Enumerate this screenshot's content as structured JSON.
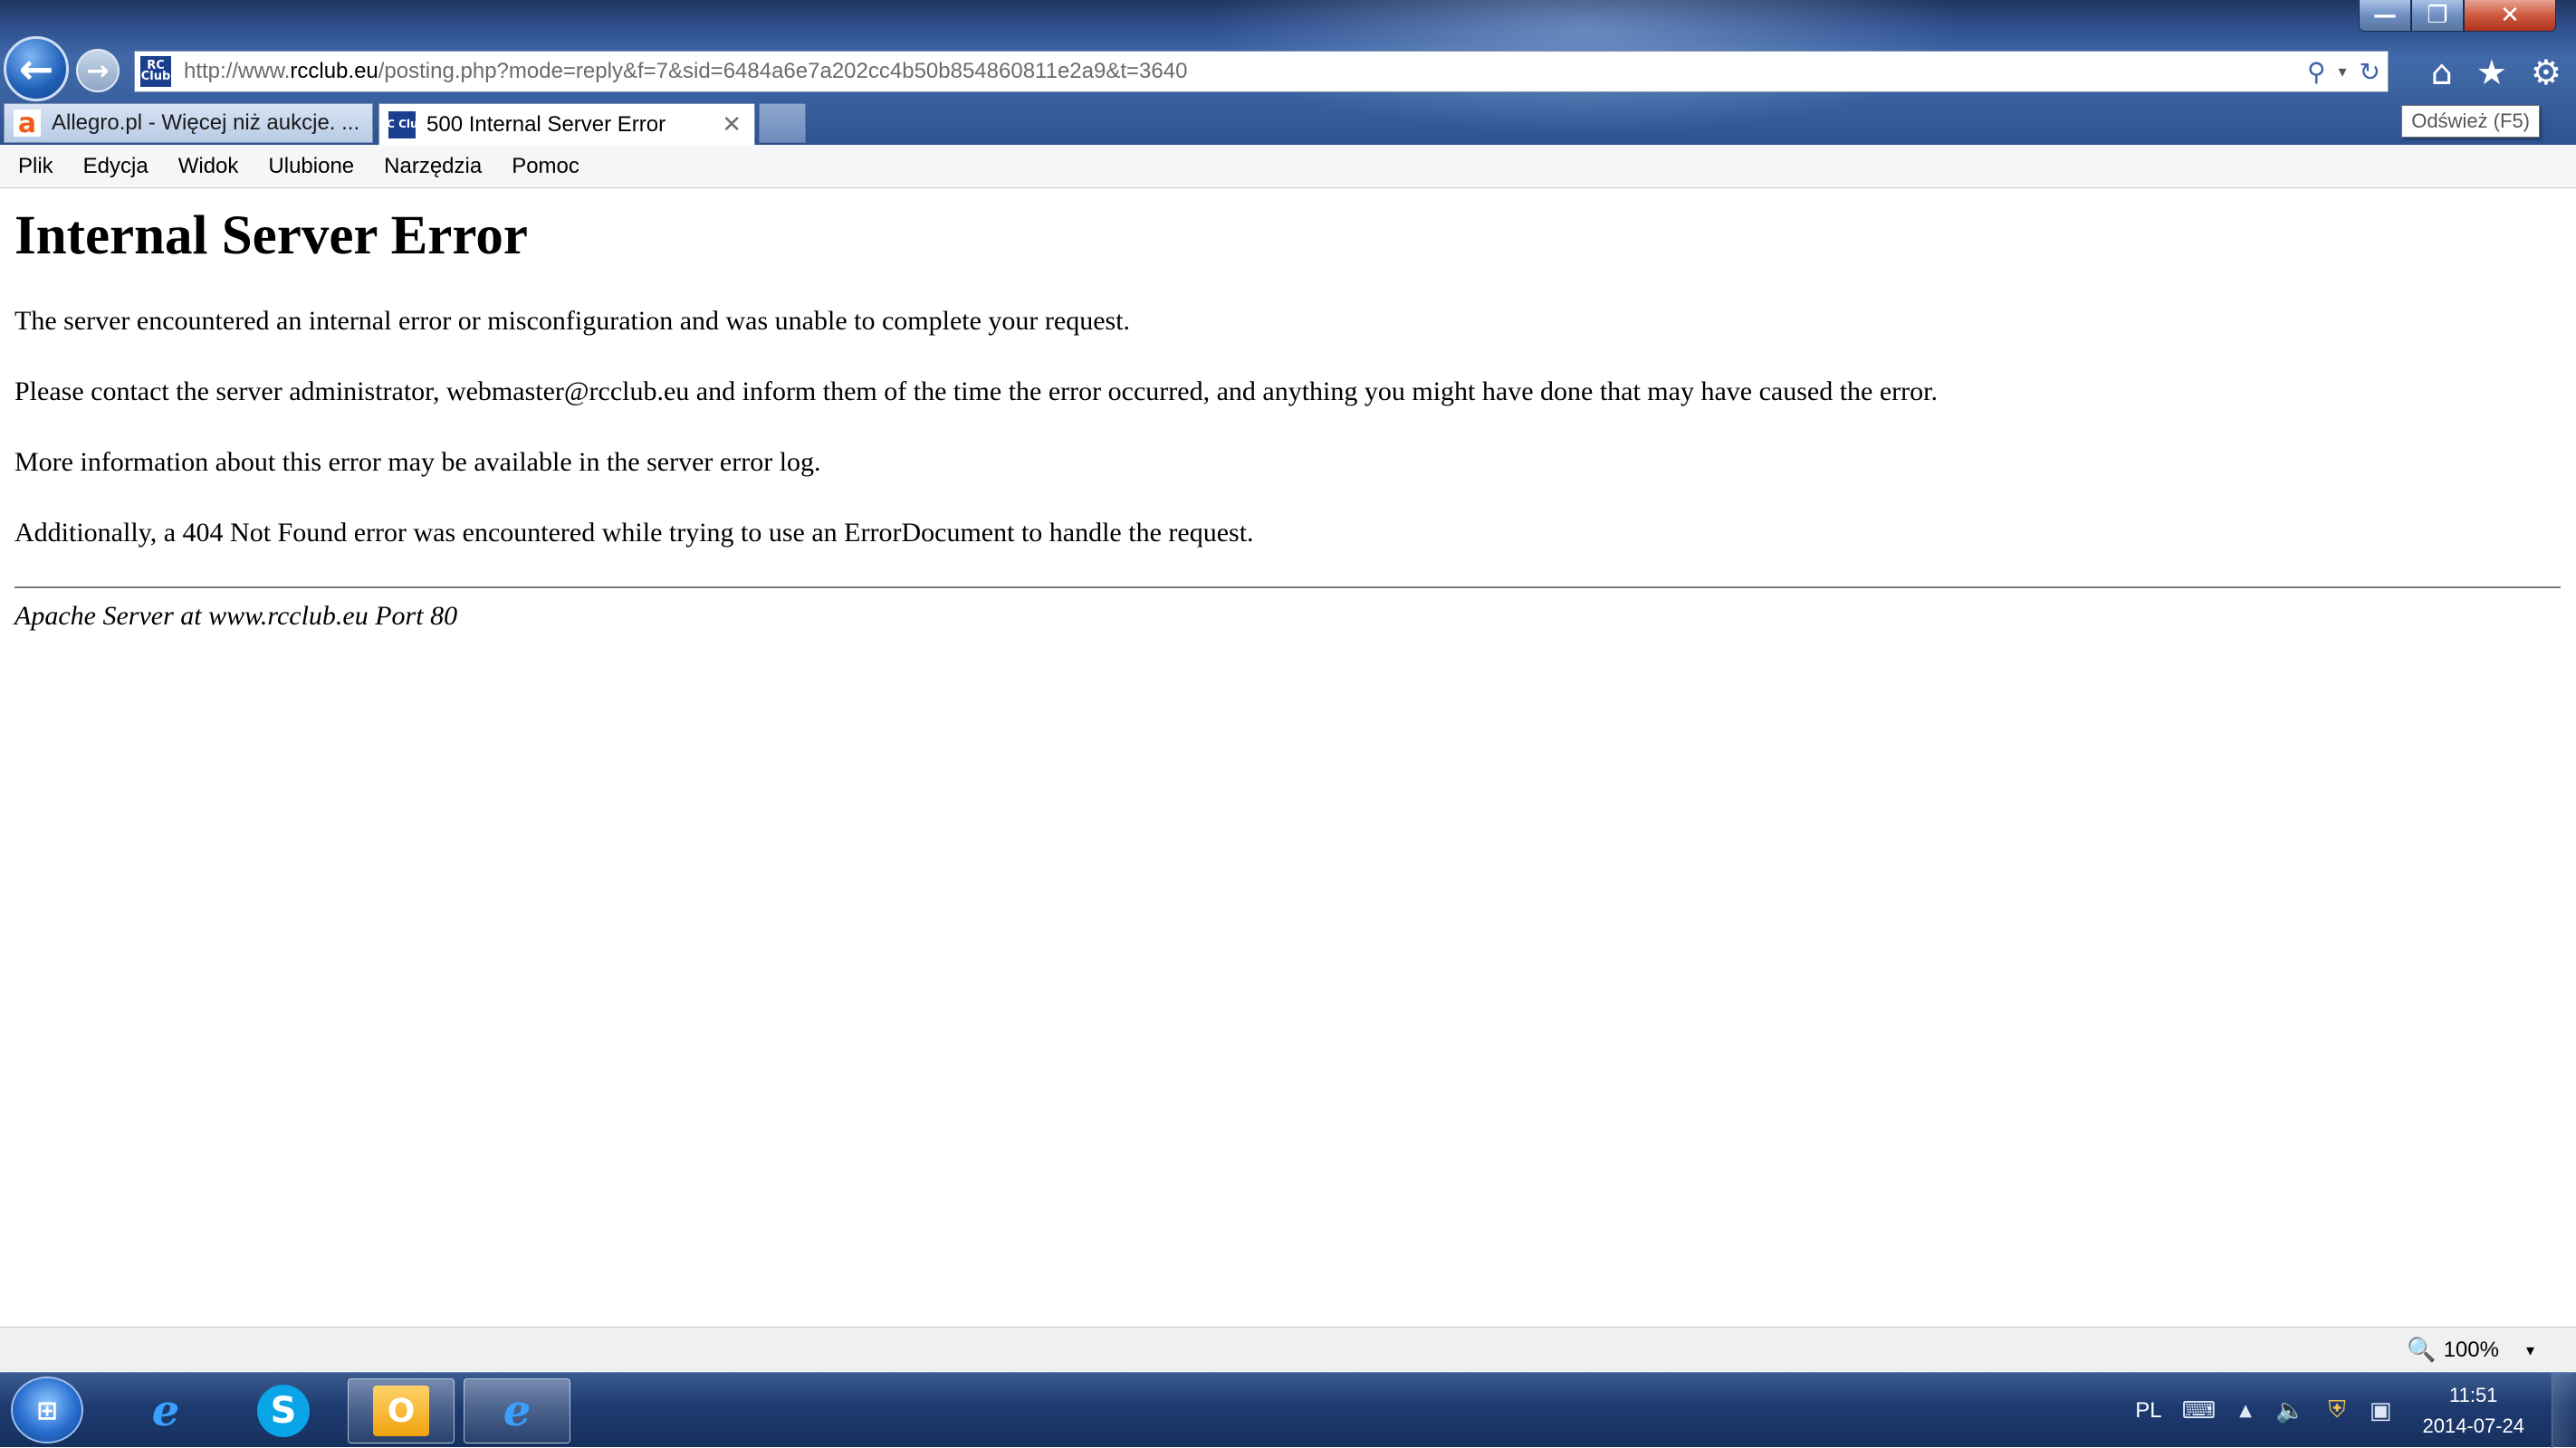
{
  "window": {
    "minimize": "—",
    "restore": "❐",
    "close": "✕"
  },
  "nav": {
    "back": "←",
    "forward": "→"
  },
  "address": {
    "site_icon": "RC Club",
    "url_prefix": "http://www.",
    "url_host": "rcclub.eu",
    "url_path": "/posting.php?mode=reply&f=7&sid=6484a6e7a202cc4b50b854860811e2a9&t=3640",
    "search_icon": "⚲",
    "dropdown_icon": "▾",
    "refresh_icon": "↻"
  },
  "toolbar_icons": {
    "home": "⌂",
    "favorites": "★",
    "tools": "⚙"
  },
  "tabs": [
    {
      "label": "Allegro.pl - Więcej niż aukcje. ...",
      "icon": "a",
      "active": false
    },
    {
      "label": "500 Internal Server Error",
      "icon": "RC Club",
      "active": true,
      "close": "✕"
    }
  ],
  "tooltip": "Odśwież (F5)",
  "menu": [
    "Plik",
    "Edycja",
    "Widok",
    "Ulubione",
    "Narzędzia",
    "Pomoc"
  ],
  "page": {
    "title": "Internal Server Error",
    "paragraphs": [
      "The server encountered an internal error or misconfiguration and was unable to complete your request.",
      "Please contact the server administrator, webmaster@rcclub.eu and inform them of the time the error occurred, and anything you might have done that may have caused the error.",
      "More information about this error may be available in the server error log.",
      "Additionally, a 404 Not Found error was encountered while trying to use an ErrorDocument to handle the request."
    ],
    "signature": "Apache Server at www.rcclub.eu Port 80"
  },
  "status": {
    "zoom": "100%",
    "zoom_icon": "🔍",
    "dropdown": "▾"
  },
  "taskbar": {
    "start_icon": "⊞",
    "apps": [
      {
        "name": "internet-explorer",
        "glyph": "e",
        "state": "pinned"
      },
      {
        "name": "skype",
        "glyph": "S",
        "state": "pinned"
      },
      {
        "name": "outlook",
        "glyph": "O",
        "state": "running"
      },
      {
        "name": "internet-explorer-running",
        "glyph": "e",
        "state": "running"
      }
    ],
    "tray": {
      "language": "PL",
      "keyboard_icon": "⌨",
      "show_hidden_icon": "▲",
      "volume_icon": "🔈",
      "security_icon": "⛨",
      "network_icon": "▣",
      "time": "11:51",
      "date": "2014-07-24"
    }
  }
}
